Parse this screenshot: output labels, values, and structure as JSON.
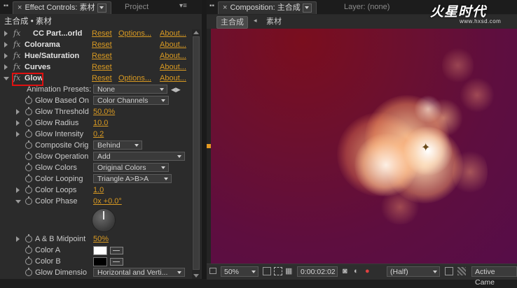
{
  "effect_panel": {
    "tab_title": "Effect Controls: 素材",
    "tab_project": "Project",
    "breadcrumb": "主合成 • 素材",
    "effects": [
      {
        "name": "CC Part...orld",
        "reset": "Reset",
        "options": "Options...",
        "about": "About..."
      },
      {
        "name": "Colorama",
        "reset": "Reset",
        "about": "About..."
      },
      {
        "name": "Hue/Saturation",
        "reset": "Reset",
        "about": "About..."
      },
      {
        "name": "Curves",
        "reset": "Reset",
        "about": "About..."
      },
      {
        "name": "Glow",
        "reset": "Reset",
        "options": "Options...",
        "about": "About..."
      }
    ],
    "fx_label": "fx",
    "animation_presets": {
      "label": "Animation Presets:",
      "value": "None"
    },
    "params": {
      "glow_based_on": {
        "label": "Glow Based On",
        "value": "Color Channels"
      },
      "glow_threshold": {
        "label": "Glow Threshold",
        "value": "50.0%"
      },
      "glow_radius": {
        "label": "Glow Radius",
        "value": "10.0"
      },
      "glow_intensity": {
        "label": "Glow Intensity",
        "value": "0.2"
      },
      "composite_orig": {
        "label": "Composite Orig",
        "value": "Behind"
      },
      "glow_operation": {
        "label": "Glow Operation",
        "value": "Add"
      },
      "glow_colors": {
        "label": "Glow Colors",
        "value": "Original Colors"
      },
      "color_looping": {
        "label": "Color Looping",
        "value": "Triangle A>B>A"
      },
      "color_loops": {
        "label": "Color Loops",
        "value": "1.0"
      },
      "color_phase": {
        "label": "Color Phase",
        "value": "0x +0.0°"
      },
      "ab_midpoint": {
        "label": "A & B Midpoint",
        "value": "50%"
      },
      "color_a": {
        "label": "Color A",
        "color": "#ffffff"
      },
      "color_b": {
        "label": "Color B",
        "color": "#000000"
      },
      "glow_dimensions": {
        "label": "Glow Dimensio",
        "value": "Horizontal and Verti..."
      }
    }
  },
  "comp_panel": {
    "tab_title": "Composition: 主合成",
    "tab_layer": "Layer: (none)",
    "subtabs": [
      "主合成",
      "素材"
    ],
    "zoom": "50%",
    "timecode": "0:00:02:02",
    "resolution": "(Half)",
    "camera": "Active Came"
  },
  "watermark": {
    "logo": "火星时代",
    "url": "www.hxsd.com"
  },
  "colors": {
    "accent": "#d99a22",
    "highlight_box": "#e01010"
  }
}
